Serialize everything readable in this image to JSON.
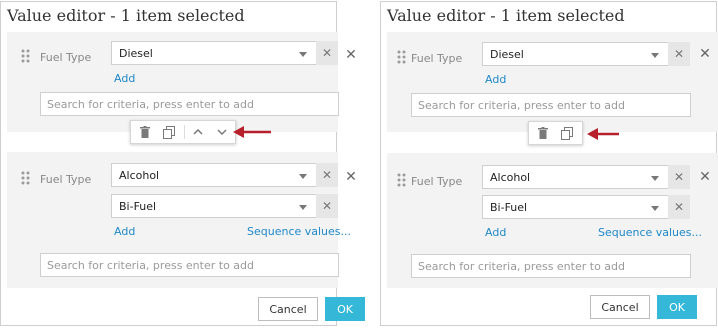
{
  "panels": [
    {
      "title": "Value editor - 1 item selected",
      "groups": [
        {
          "criteria_label": "Fuel Type",
          "values": [
            "Diesel"
          ],
          "links": {
            "add": "Add",
            "sequence": ""
          },
          "search_placeholder": "Search for criteria, press enter to add"
        },
        {
          "criteria_label": "Fuel Type",
          "values": [
            "Alcohol",
            "Bi-Fuel"
          ],
          "links": {
            "add": "Add",
            "sequence": "Sequence values..."
          },
          "search_placeholder": "Search for criteria, press enter to add"
        }
      ],
      "toolbar": {
        "icons": [
          "trash-icon",
          "copy-icon",
          "chevron-up-icon",
          "chevron-down-icon"
        ]
      },
      "buttons": {
        "cancel": "Cancel",
        "ok": "OK"
      }
    },
    {
      "title": "Value editor - 1 item selected",
      "groups": [
        {
          "criteria_label": "Fuel Type",
          "values": [
            "Diesel"
          ],
          "links": {
            "add": "Add",
            "sequence": ""
          },
          "search_placeholder": "Search for criteria, press enter to add"
        },
        {
          "criteria_label": "Fuel Type",
          "values": [
            "Alcohol",
            "Bi-Fuel"
          ],
          "links": {
            "add": "Add",
            "sequence": "Sequence values..."
          },
          "search_placeholder": "Search for criteria, press enter to add"
        }
      ],
      "toolbar": {
        "icons": [
          "trash-icon",
          "copy-icon"
        ]
      },
      "buttons": {
        "cancel": "Cancel",
        "ok": "OK"
      }
    }
  ],
  "colors": {
    "link": "#1e88c8",
    "ok_button": "#35b8d8",
    "annotation_arrow": "#b5202a"
  }
}
